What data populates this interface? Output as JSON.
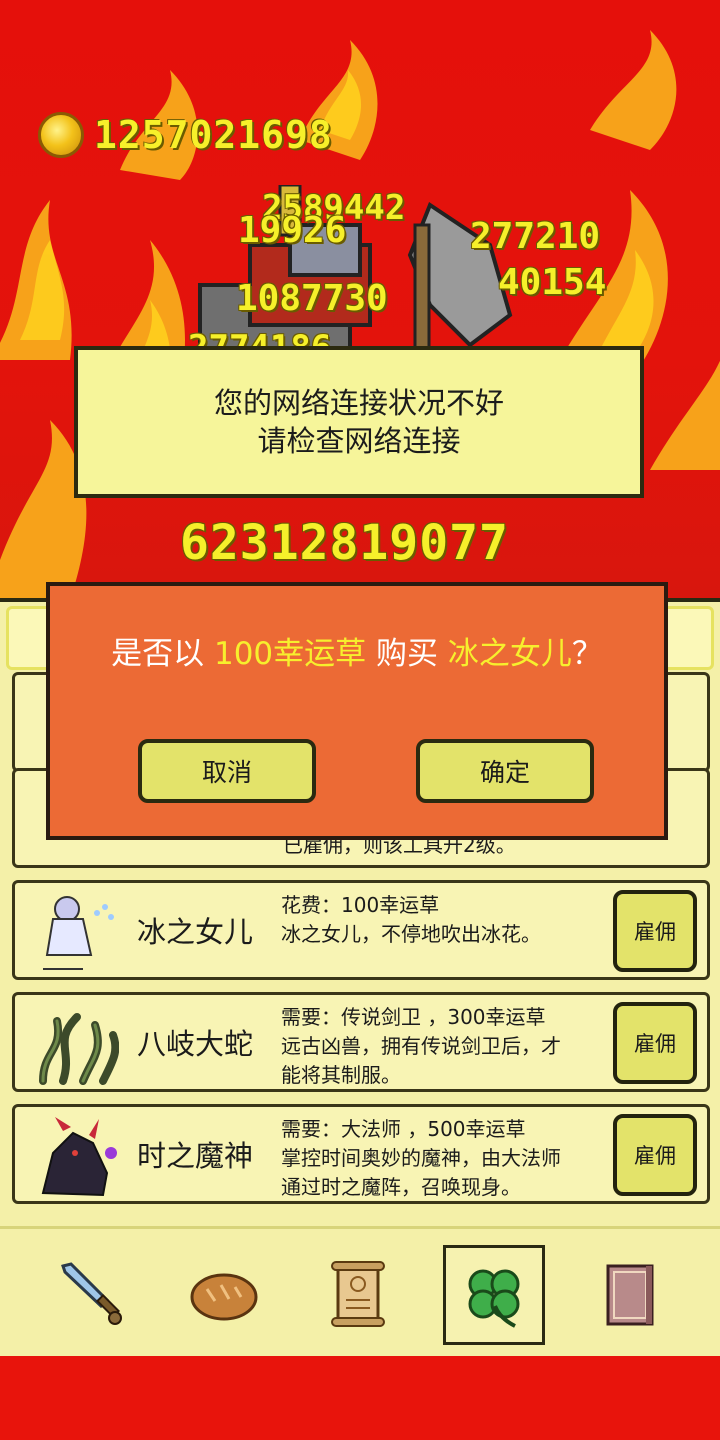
{
  "hud": {
    "coins": "1257021698"
  },
  "damage_numbers": {
    "n1": "2589442",
    "n2": "19926",
    "n3": "277210",
    "n4": "40154",
    "n5": "1087730",
    "n6": "2774186",
    "total": "62312819077"
  },
  "network_toast": {
    "line1": "您的网络连接状况不好",
    "line2": "请检查网络连接"
  },
  "confirm_dialog": {
    "prefix": "是否以",
    "price": "100幸运草",
    "middle": "购买",
    "item": "冰之女儿",
    "suffix": "？",
    "cancel_label": "取消",
    "ok_label": "确定"
  },
  "hidden_row_text": "已雇佣，则该工具升2级。",
  "heroes": [
    {
      "name": "冰之女儿",
      "line1": "花费：100幸运草",
      "line2": "冰之女儿，不停地吹出冰花。",
      "line3": "",
      "hire_label": "雇佣"
    },
    {
      "name": "八岐大蛇",
      "line1": "需要：传说剑卫 ，300幸运草",
      "line2": "远古凶兽，拥有传说剑卫后，才",
      "line3": "能将其制服。",
      "hire_label": "雇佣"
    },
    {
      "name": "时之魔神",
      "line1": "需要：大法师 ，500幸运草",
      "line2": "掌控时间奥妙的魔神，由大法师",
      "line3": "通过时之魔阵，召唤现身。",
      "hire_label": "雇佣"
    }
  ],
  "nav": {
    "items": [
      "sword-icon",
      "bread-icon",
      "scroll-icon",
      "clover-icon",
      "book-icon"
    ],
    "active": "clover-icon"
  },
  "colors": {
    "background_red": "#e8140c",
    "panel_yellow": "#f4f0a8",
    "dialog_orange": "#ec6a35",
    "highlight_yellow": "#f7ef2d"
  }
}
